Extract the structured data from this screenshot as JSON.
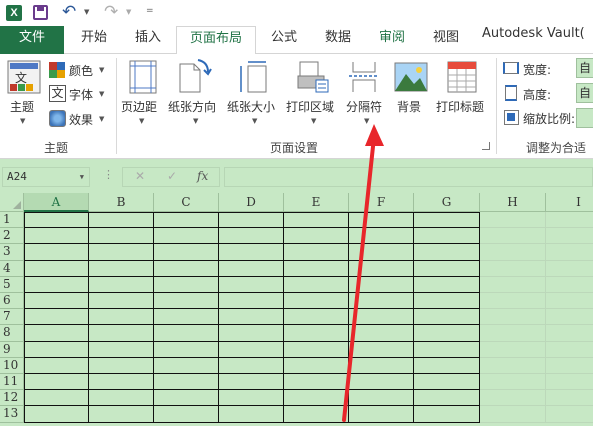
{
  "quick_access": {
    "logo_text": "X",
    "more_glyph": "="
  },
  "tabs": [
    {
      "label": "文件"
    },
    {
      "label": "开始"
    },
    {
      "label": "插入"
    },
    {
      "label": "页面布局"
    },
    {
      "label": "公式"
    },
    {
      "label": "数据"
    },
    {
      "label": "审阅"
    },
    {
      "label": "视图"
    },
    {
      "label": "Autodesk Vault("
    }
  ],
  "ribbon": {
    "theme_group": {
      "theme_label": "主题",
      "colors_label": "颜色",
      "fonts_label": "字体",
      "effects_label": "效果",
      "theme_icon_text": "文",
      "fonts_icon_text": "文",
      "group_label": "主题"
    },
    "page_setup_group": {
      "margins_label": "页边距",
      "orientation_label": "纸张方向",
      "size_label": "纸张大小",
      "print_area_label": "打印区域",
      "breaks_label": "分隔符",
      "background_label": "背景",
      "print_titles_label": "打印标题",
      "group_label": "页面设置"
    },
    "scale_group": {
      "width_label": "宽度:",
      "height_label": "高度:",
      "scale_label": "缩放比例:",
      "width_value": "自",
      "height_value": "自",
      "group_label": "调整为合适"
    }
  },
  "formula_bar": {
    "name_box": "A24",
    "cancel_symbol": "✕",
    "enter_symbol": "✓",
    "fx_symbol": "fx",
    "formula_value": ""
  },
  "sheet": {
    "columns": [
      "A",
      "B",
      "C",
      "D",
      "E",
      "F",
      "G",
      "H",
      "I"
    ],
    "rows": [
      "1",
      "2",
      "3",
      "4",
      "5",
      "6",
      "7",
      "8",
      "9",
      "10",
      "11",
      "12",
      "13"
    ],
    "selected_column": "A"
  },
  "colors": {
    "accent": "#217346",
    "sheet_bg": "#c7e8c5",
    "arrow": "#e8262b"
  }
}
